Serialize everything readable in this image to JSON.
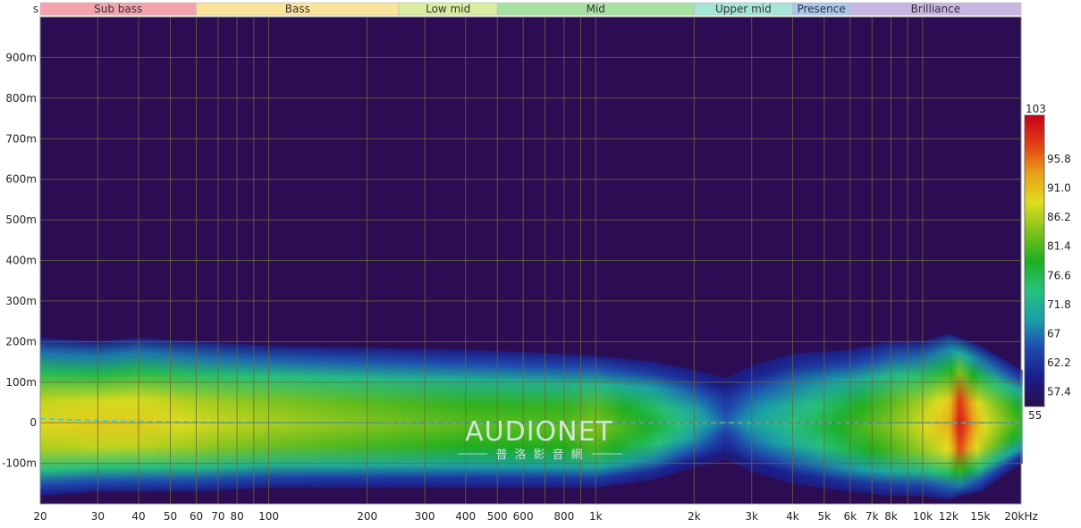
{
  "chart_data": {
    "type": "heatmap",
    "y_unit_label": "s",
    "x_unit_label": "kHz",
    "x_scale": "log",
    "xlim": [
      20,
      20000
    ],
    "ylim": [
      -0.2,
      1.0
    ],
    "bands": [
      {
        "label": "Sub bass",
        "from": 20,
        "to": 60,
        "color": "#f4a3ad"
      },
      {
        "label": "Bass",
        "from": 60,
        "to": 250,
        "color": "#fbe39a"
      },
      {
        "label": "Low mid",
        "from": 250,
        "to": 500,
        "color": "#d9eea0"
      },
      {
        "label": "Mid",
        "from": 500,
        "to": 2000,
        "color": "#a8e2a3"
      },
      {
        "label": "Upper mid",
        "from": 2000,
        "to": 4000,
        "color": "#a6e6d8"
      },
      {
        "label": "Presence",
        "from": 4000,
        "to": 6000,
        "color": "#a9c7ee"
      },
      {
        "label": "Brilliance",
        "from": 6000,
        "to": 20000,
        "color": "#c8b6e2"
      }
    ],
    "y_ticks": [
      {
        "value": 0.9,
        "label": "900m"
      },
      {
        "value": 0.8,
        "label": "800m"
      },
      {
        "value": 0.7,
        "label": "700m"
      },
      {
        "value": 0.6,
        "label": "600m"
      },
      {
        "value": 0.5,
        "label": "500m"
      },
      {
        "value": 0.4,
        "label": "400m"
      },
      {
        "value": 0.3,
        "label": "300m"
      },
      {
        "value": 0.2,
        "label": "200m"
      },
      {
        "value": 0.1,
        "label": "100m"
      },
      {
        "value": 0.0,
        "label": "0"
      },
      {
        "value": -0.1,
        "label": "-100m"
      }
    ],
    "x_ticks": [
      {
        "value": 20,
        "label": "20"
      },
      {
        "value": 30,
        "label": "30"
      },
      {
        "value": 40,
        "label": "40"
      },
      {
        "value": 50,
        "label": "50"
      },
      {
        "value": 60,
        "label": "60"
      },
      {
        "value": 70,
        "label": "70"
      },
      {
        "value": 80,
        "label": "80"
      },
      {
        "value": 100,
        "label": "100"
      },
      {
        "value": 200,
        "label": "200"
      },
      {
        "value": 300,
        "label": "300"
      },
      {
        "value": 400,
        "label": "400"
      },
      {
        "value": 500,
        "label": "500"
      },
      {
        "value": 600,
        "label": "600"
      },
      {
        "value": 800,
        "label": "800"
      },
      {
        "value": 1000,
        "label": "1k"
      },
      {
        "value": 2000,
        "label": "2k"
      },
      {
        "value": 3000,
        "label": "3k"
      },
      {
        "value": 4000,
        "label": "4k"
      },
      {
        "value": 5000,
        "label": "5k"
      },
      {
        "value": 6000,
        "label": "6k"
      },
      {
        "value": 7000,
        "label": "7k"
      },
      {
        "value": 8000,
        "label": "8k"
      },
      {
        "value": 10000,
        "label": "10k"
      },
      {
        "value": 12000,
        "label": "12k",
        "muted": true
      },
      {
        "value": 15000,
        "label": "15k"
      },
      {
        "value": 20000,
        "label": "20kHz"
      }
    ],
    "x_grid": [
      20,
      30,
      40,
      50,
      60,
      70,
      80,
      90,
      100,
      200,
      300,
      400,
      500,
      600,
      700,
      800,
      900,
      1000,
      2000,
      3000,
      4000,
      5000,
      6000,
      7000,
      8000,
      9000,
      10000,
      20000
    ],
    "colorbar": {
      "min": 55,
      "max": 103,
      "ticks": [
        "103",
        "95.8",
        "91.0",
        "86.2",
        "81.4",
        "76.6",
        "71.8",
        "67",
        "62.2",
        "57.4",
        "55"
      ],
      "tick_values": [
        103,
        95.8,
        91.0,
        86.2,
        81.4,
        76.6,
        71.8,
        67,
        62.2,
        57.4,
        55
      ],
      "colors": [
        "#2a0e4f",
        "#1a1d8a",
        "#1f4ab0",
        "#1aa0a8",
        "#27c07c",
        "#1fae1f",
        "#7fc21e",
        "#e0dc1e",
        "#e8a01a",
        "#e04014",
        "#c8001a"
      ]
    },
    "decay_profile": {
      "freq_hz": [
        20,
        30,
        40,
        60,
        100,
        200,
        400,
        800,
        1000,
        1500,
        2000,
        2500,
        3000,
        4000,
        6000,
        8000,
        10000,
        12000,
        13000,
        15000,
        20000
      ],
      "upper_edge_s": [
        0.21,
        0.2,
        0.21,
        0.2,
        0.19,
        0.185,
        0.18,
        0.17,
        0.165,
        0.15,
        0.13,
        0.11,
        0.14,
        0.17,
        0.18,
        0.2,
        0.2,
        0.22,
        0.21,
        0.19,
        0.13
      ],
      "lower_edge_s": [
        -0.18,
        -0.17,
        -0.17,
        -0.17,
        -0.16,
        -0.16,
        -0.16,
        -0.16,
        -0.16,
        -0.14,
        -0.11,
        -0.09,
        -0.12,
        -0.15,
        -0.17,
        -0.18,
        -0.18,
        -0.19,
        -0.18,
        -0.17,
        -0.1
      ],
      "peak_level": [
        89,
        90,
        90,
        88,
        86,
        84,
        82,
        82,
        84,
        78,
        72,
        66,
        70,
        74,
        80,
        84,
        88,
        92,
        101,
        90,
        80
      ]
    },
    "dashed_line": {
      "color": "#3fd0e0",
      "x": [
        20,
        30,
        50,
        100,
        1000,
        20000
      ],
      "y": [
        0.01,
        0.005,
        0.002,
        0.0,
        0.0,
        0.0
      ]
    },
    "background_color": "#2c0c52",
    "grid_color": "#6a6a3a"
  },
  "watermark": {
    "title": "AUDIONET",
    "subtitle": "普洛影音網"
  }
}
